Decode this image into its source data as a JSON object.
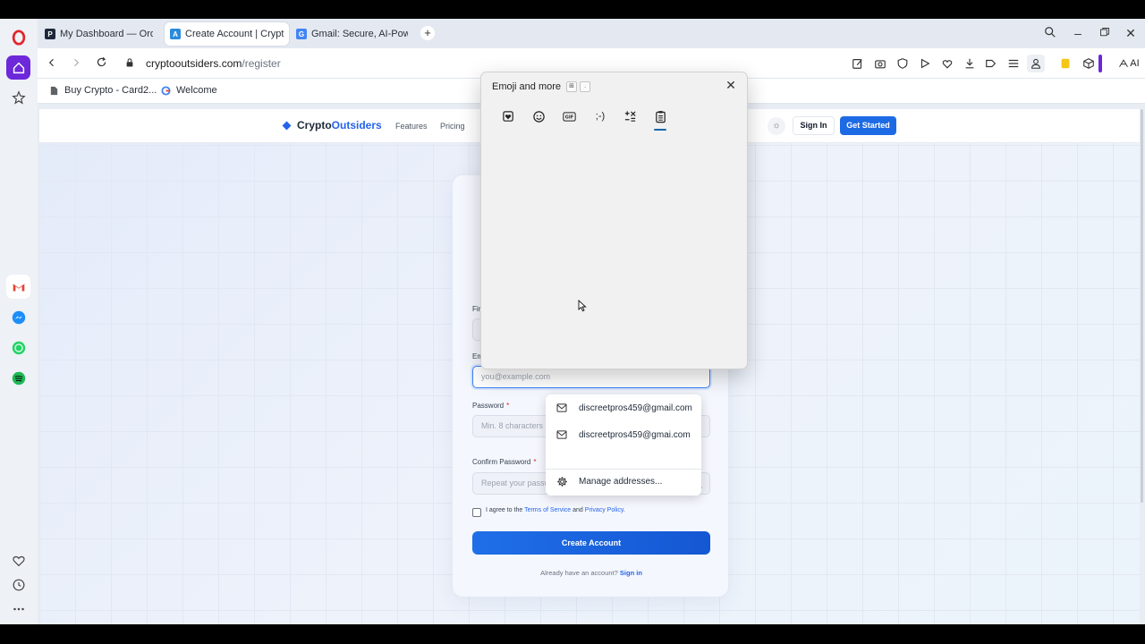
{
  "browser": {
    "tabs": [
      {
        "label": "My Dashboard — Orders",
        "favicon": "P",
        "color": "#1e293b"
      },
      {
        "label": "Create Account | CryptoOu",
        "favicon": "A",
        "color": "#2a8bdc"
      },
      {
        "label": "Gmail: Secure, AI-Powered",
        "favicon": "G",
        "color": "#4285f4"
      }
    ],
    "new_tab_symbol": "+",
    "url_domain": "cryptooutsiders.com",
    "url_path": "/register",
    "ai_label": "AI",
    "bookmarks": [
      {
        "label": "Buy Crypto - Card2..."
      },
      {
        "label": "Welcome"
      }
    ]
  },
  "site": {
    "brand_part1": "Crypto",
    "brand_part2": "Outsiders",
    "nav": [
      "Features",
      "Pricing"
    ],
    "sign_in": "Sign In",
    "get_started": "Get Started"
  },
  "form": {
    "first_label_partial": "Fir",
    "email_label_partial": "Em",
    "email_placeholder": "you@example.com",
    "password_label": "Password",
    "password_placeholder": "Min. 8 characters",
    "confirm_label": "Confirm Password",
    "confirm_placeholder": "Repeat your password",
    "required_mark": "*",
    "agree_prefix": "I agree to the ",
    "terms": "Terms of Service",
    "and": " and ",
    "privacy": "Privacy Policy",
    "agree_suffix": ".",
    "create_button": "Create Account",
    "already": "Already have an account? ",
    "sign_in_link": "Sign in"
  },
  "autofill": {
    "items": [
      {
        "label": "discreetpros459@gmail.com",
        "icon": "mail-icon"
      },
      {
        "label": "discreetpros459@gmai.com",
        "icon": "mail-icon"
      },
      {
        "label": "Manage addresses...",
        "icon": "gear-icon"
      }
    ]
  },
  "emoji_panel": {
    "title": "Emoji and more",
    "shortcut_key1": "⊞",
    "shortcut_key2": ".",
    "tabs": [
      "favorites",
      "emoji",
      "gif",
      "kaomoji",
      "symbols",
      "clipboard"
    ],
    "gif_label": "GIF",
    "kaomoji_label": ";-)"
  },
  "colors": {
    "accent": "#1d6ae5",
    "opera_red": "#e0262e",
    "opera_sidebar_active": "#6d28d9"
  }
}
